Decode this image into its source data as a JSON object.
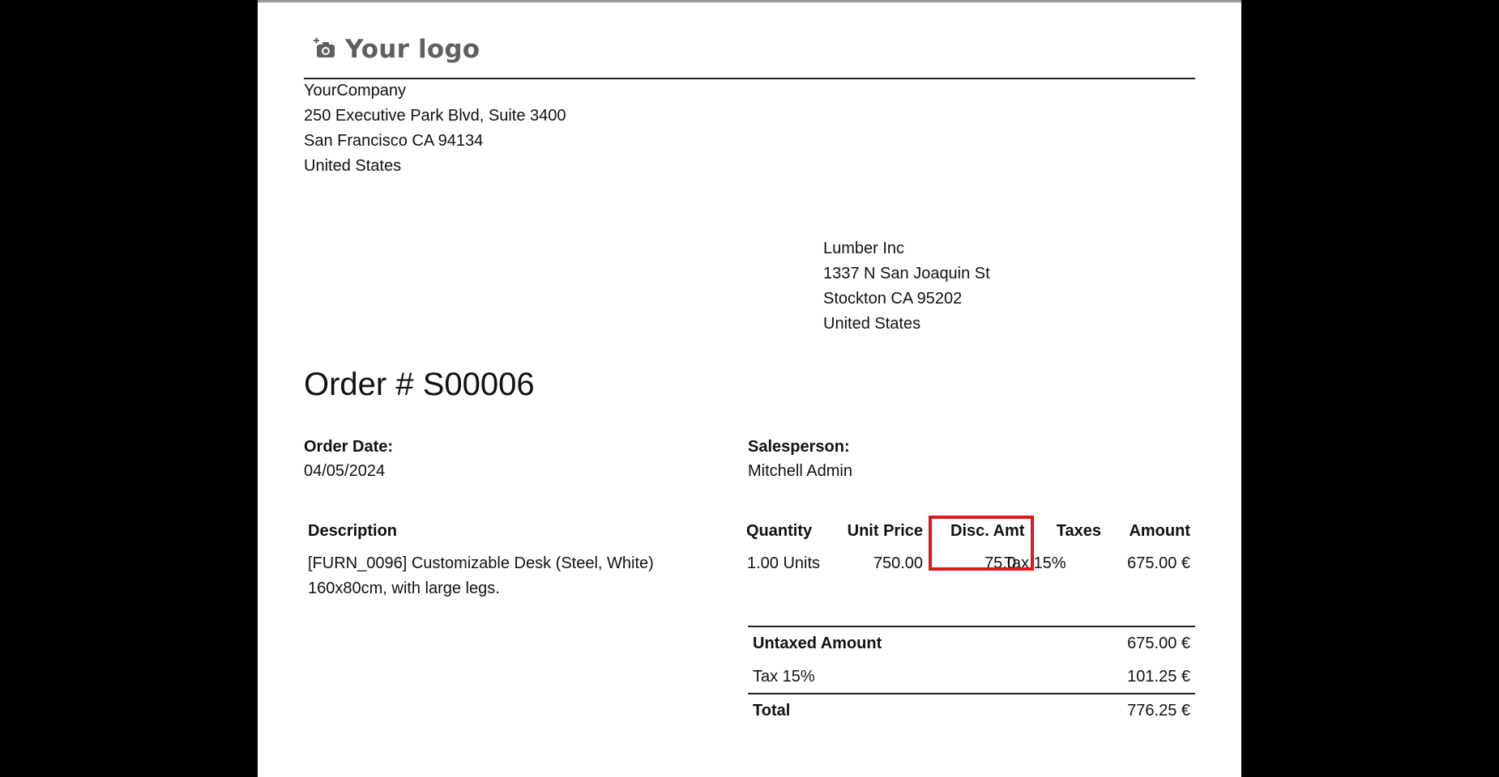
{
  "logo": {
    "text": "Your logo",
    "icon": "camera-plus-icon"
  },
  "company": {
    "name": "YourCompany",
    "street": "250 Executive Park Blvd, Suite 3400",
    "city_line": "San Francisco CA 94134",
    "country": "United States"
  },
  "customer": {
    "name": "Lumber Inc",
    "street": "1337 N San Joaquin St",
    "city_line": "Stockton CA 95202",
    "country": "United States"
  },
  "order": {
    "title": "Order # S00006",
    "date_label": "Order Date:",
    "date_value": "04/05/2024",
    "salesperson_label": "Salesperson:",
    "salesperson_value": "Mitchell Admin"
  },
  "lines": {
    "headers": {
      "description": "Description",
      "quantity": "Quantity",
      "unit_price": "Unit Price",
      "discount": "Disc. Amt",
      "taxes": "Taxes",
      "amount": "Amount"
    },
    "rows": [
      {
        "description_line1": "[FURN_0096] Customizable Desk (Steel, White)",
        "description_line2": "160x80cm, with large legs.",
        "quantity": "1.00 Units",
        "unit_price": "750.00",
        "discount": "75.0",
        "taxes": "Tax 15%",
        "amount": "675.00 €"
      }
    ]
  },
  "totals": {
    "untaxed_label": "Untaxed Amount",
    "untaxed_value": "675.00 €",
    "tax_label": "Tax 15%",
    "tax_value": "101.25 €",
    "total_label": "Total",
    "total_value": "776.25 €"
  },
  "colors": {
    "highlight": "#e0161b",
    "logo_text": "#5f5f5f",
    "backdrop": "#000000"
  }
}
